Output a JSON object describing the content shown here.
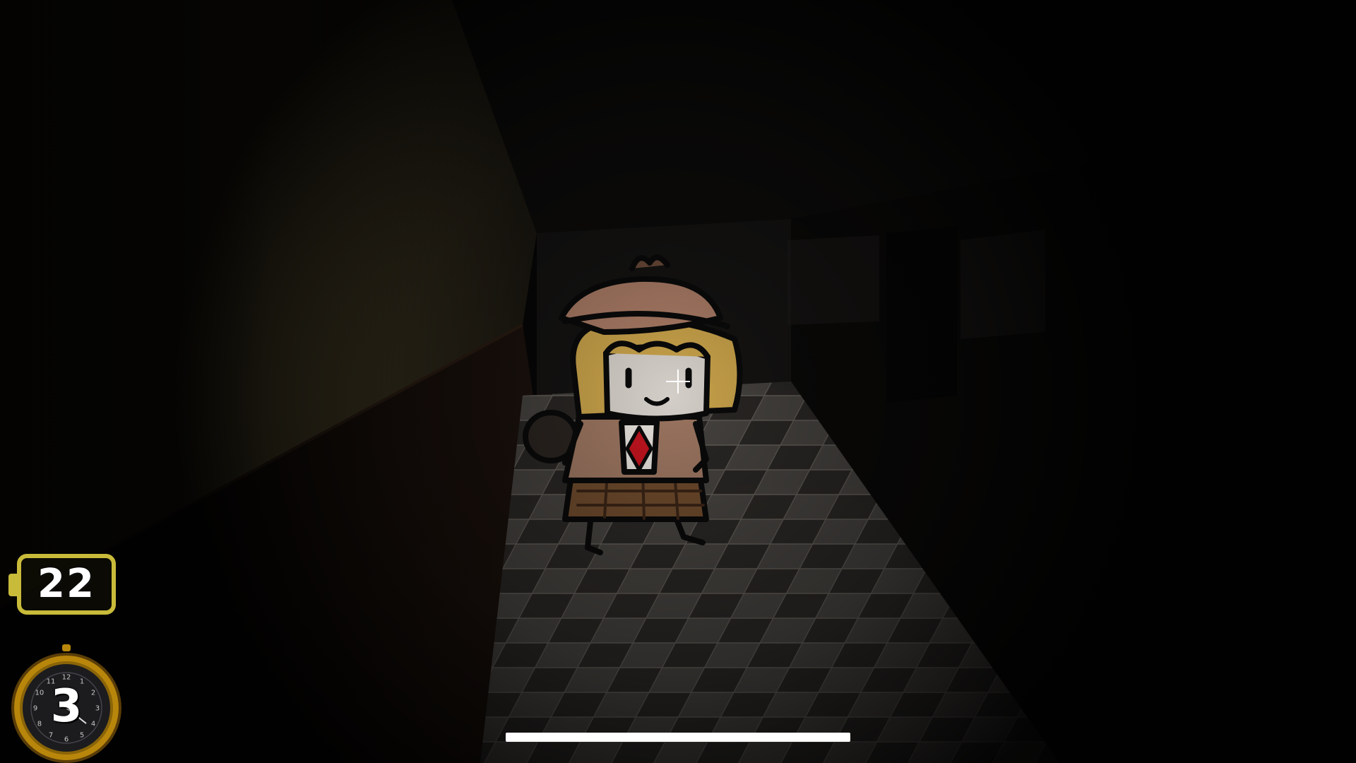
{
  "hud": {
    "battery": {
      "value": "22",
      "color": "#c9bb3a",
      "icon": "battery-icon"
    },
    "watch": {
      "value": "3",
      "icon": "pocket-watch-icon",
      "dial_numbers": [
        "12",
        "1",
        "2",
        "3",
        "4",
        "5",
        "6",
        "7",
        "8",
        "9",
        "10",
        "11"
      ],
      "frame_color": "#b8860b"
    }
  },
  "scene": {
    "description_icon": "dark-hallway-scene",
    "character": "detective-girl-character"
  },
  "crosshair": {
    "icon": "crosshair-icon"
  },
  "system": {
    "home_indicator": "home-indicator-bar"
  }
}
